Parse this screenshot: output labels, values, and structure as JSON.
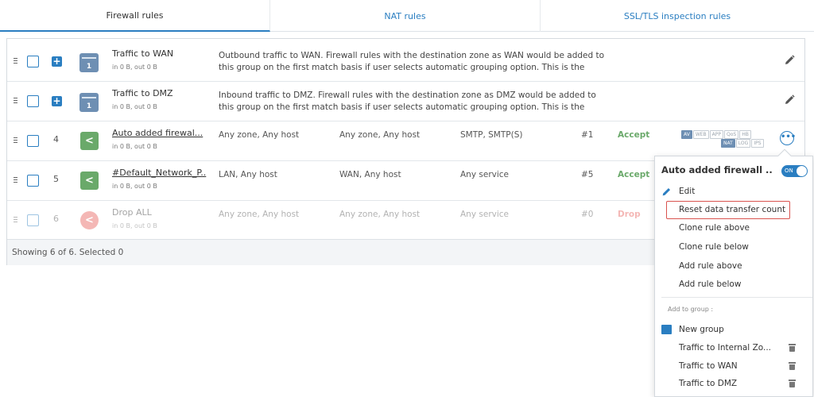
{
  "tabs": [
    {
      "label": "Firewall rules",
      "active": true
    },
    {
      "label": "NAT rules",
      "active": false
    },
    {
      "label": "SSL/TLS inspection rules",
      "active": false
    }
  ],
  "rows": [
    {
      "kind": "group",
      "number": "1",
      "name": "Traffic to WAN",
      "sub": "in 0 B, out 0 B",
      "description": "Outbound traffic to WAN. Firewall rules with the destination zone as WAN would be added to this group on the first match basis if user selects automatic grouping option. This is the de..."
    },
    {
      "kind": "group",
      "number": "1",
      "name": "Traffic to DMZ",
      "sub": "in 0 B, out 0 B",
      "description": "Inbound traffic to DMZ. Firewall rules with the destination zone as DMZ would be added to this group on the first match basis if user selects automatic grouping option. This is the de..."
    },
    {
      "kind": "rule",
      "index": "4",
      "name": "Auto added firewal...",
      "sub": "in 0 B, out 0 B",
      "source": "Any zone, Any host",
      "destination": "Any zone, Any host",
      "service": "SMTP, SMTP(S)",
      "id": "#1",
      "action": "Accept"
    },
    {
      "kind": "rule",
      "index": "5",
      "name": "#Default_Network_P..",
      "sub": "in 0 B, out 0 B",
      "source": "LAN, Any host",
      "destination": "WAN, Any host",
      "service": "Any service",
      "id": "#5",
      "action": "Accept"
    },
    {
      "kind": "rule",
      "index": "6",
      "name": "Drop ALL",
      "sub": "in 0 B, out 0 B",
      "source": "Any zone, Any host",
      "destination": "Any zone, Any host",
      "service": "Any service",
      "id": "#0",
      "action": "Drop"
    }
  ],
  "security_tags": {
    "row1": [
      "AV",
      "WEB",
      "APP",
      "QoS",
      "HB"
    ],
    "row2": [
      "NAT",
      "LOG",
      "IPS"
    ],
    "active": [
      "AV",
      "NAT"
    ]
  },
  "footer": {
    "status": "Showing 6 of 6. Selected 0"
  },
  "context_menu": {
    "title": "Auto added firewall ...",
    "toggle_label": "ON",
    "items": [
      "Edit",
      "Reset data transfer count",
      "Clone rule above",
      "Clone rule below",
      "Add rule above",
      "Add rule below"
    ],
    "group_label": "Add to group :",
    "new_group": "New group",
    "groups": [
      "Traffic to Internal Zo...",
      "Traffic to WAN",
      "Traffic to DMZ"
    ]
  },
  "colors": {
    "accent": "#2a7ec1",
    "accept": "#6aa96a",
    "drop": "#e7625c",
    "highlight_border": "#d9534f"
  }
}
